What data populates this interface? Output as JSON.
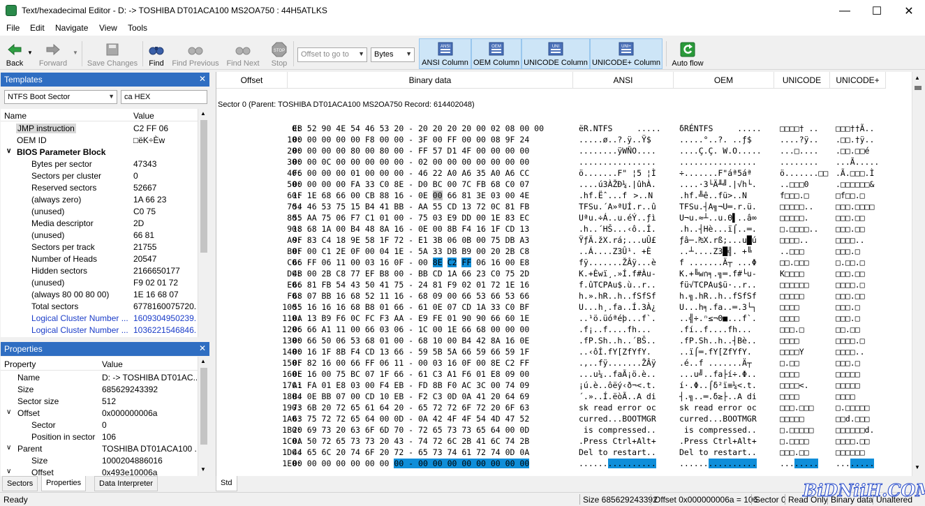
{
  "window": {
    "title": "Text/hexadecimal Editor - D: -> TOSHIBA DT01ACA100 MS2OA750 : 44H5ATLKS",
    "minimize": "—",
    "maximize": "☐",
    "close": "✕"
  },
  "menu": [
    "File",
    "Edit",
    "Navigate",
    "View",
    "Tools"
  ],
  "toolbar": {
    "back": "Back",
    "forward": "Forward",
    "save_changes": "Save Changes",
    "find": "Find",
    "find_previous": "Find Previous",
    "find_next": "Find Next",
    "stop": "Stop",
    "stop_icon_text": "STOP",
    "offset_placeholder": "Offset to go to",
    "units": "Bytes",
    "ansi_column": "ANSI Column",
    "oem_column": "OEM Column",
    "unicode_column": "UNICODE Column",
    "unicode_plus_column": "UNICODE+ Column",
    "auto_flow": "Auto flow",
    "icon_ansi": "ANSI",
    "icon_oem": "OEM",
    "icon_uni": "UNI",
    "icon_uni_plus": "UNI+"
  },
  "templates_panel": {
    "title": "Templates",
    "close": "✕",
    "template_select": "NTFS Boot Sector",
    "search_value": "ca HEX",
    "col_name": "Name",
    "col_value": "Value",
    "rows": [
      {
        "name": "JMP instruction",
        "value": "C2 FF 06",
        "indent": 0,
        "style": "sel"
      },
      {
        "name": "OEM ID",
        "value": "□ëK÷Èw",
        "indent": 0,
        "style": ""
      },
      {
        "name": "BIOS Parameter Block",
        "value": "",
        "indent": 0,
        "style": "bold",
        "toggle": "∨"
      },
      {
        "name": "Bytes per sector",
        "value": "47343",
        "indent": 1,
        "style": ""
      },
      {
        "name": "Sectors per cluster",
        "value": "0",
        "indent": 1,
        "style": ""
      },
      {
        "name": "Reserved sectors",
        "value": "52667",
        "indent": 1,
        "style": ""
      },
      {
        "name": "(always zero)",
        "value": "1A 66 23",
        "indent": 1,
        "style": ""
      },
      {
        "name": "(unused)",
        "value": "C0 75",
        "indent": 1,
        "style": ""
      },
      {
        "name": "Media descriptor",
        "value": "2D",
        "indent": 1,
        "style": ""
      },
      {
        "name": "(unused)",
        "value": "66 81",
        "indent": 1,
        "style": ""
      },
      {
        "name": "Sectors per track",
        "value": "21755",
        "indent": 1,
        "style": ""
      },
      {
        "name": "Number of Heads",
        "value": "20547",
        "indent": 1,
        "style": ""
      },
      {
        "name": "Hidden sectors",
        "value": "2166650177",
        "indent": 1,
        "style": ""
      },
      {
        "name": "(unused)",
        "value": "F9 02 01 72",
        "indent": 1,
        "style": ""
      },
      {
        "name": "(always 80 00 80 00)",
        "value": "1E 16 68 07",
        "indent": 1,
        "style": ""
      },
      {
        "name": "Total sectors",
        "value": "6778160075720...",
        "indent": 1,
        "style": ""
      },
      {
        "name": "Logical Cluster Number ...",
        "value": "1609304950239...",
        "indent": 1,
        "style": "link"
      },
      {
        "name": "Logical Cluster Number ...",
        "value": "1036221546846...",
        "indent": 1,
        "style": "link"
      }
    ]
  },
  "properties_panel": {
    "title": "Properties",
    "close": "✕",
    "col_property": "Property",
    "col_value": "Value",
    "rows": [
      {
        "name": "Name",
        "value": "D: -> TOSHIBA DT01AC...",
        "indent": 1,
        "toggle": ""
      },
      {
        "name": "Size",
        "value": "685629243392",
        "indent": 1,
        "toggle": ""
      },
      {
        "name": "Sector size",
        "value": "512",
        "indent": 1,
        "toggle": ""
      },
      {
        "name": "Offset",
        "value": "0x000000006a",
        "indent": 1,
        "toggle": "∨"
      },
      {
        "name": "Sector",
        "value": "0",
        "indent": 2,
        "toggle": ""
      },
      {
        "name": "Position in sector",
        "value": "106",
        "indent": 2,
        "toggle": ""
      },
      {
        "name": "Parent",
        "value": "TOSHIBA DT01ACA100 ...",
        "indent": 1,
        "toggle": "∨"
      },
      {
        "name": "Size",
        "value": "1000204886016",
        "indent": 2,
        "toggle": ""
      },
      {
        "name": "Offset",
        "value": "0x493e10006a",
        "indent": 2,
        "toggle": "∨"
      }
    ],
    "tabs": [
      "Sectors",
      "Properties",
      "Data Interpreter"
    ]
  },
  "hex": {
    "columns": [
      "Offset",
      "Binary data",
      "ANSI",
      "OEM",
      "UNICODE",
      "UNICODE+"
    ],
    "sector_label": "Sector 0 (Parent: TOSHIBA DT01ACA100 MS2OA750 Record: 614402048)",
    "bottom_tab": "Std",
    "rows": [
      {
        "o": "0:",
        "b": "EB 52 90 4E 54 46 53 20 - 20 20 20 20 00 02 08 00 00",
        "a": "ëR.NTFS     .....",
        "m": "δRÉNTFS     .....",
        "u": "□□□□† ..",
        "p": "□□□††Ã.."
      },
      {
        "o": "10:",
        "b": "00 00 00 00 00 F8 00 00 - 3F 00 FF 00 00 08 9F 24",
        "a": ".....ø..?.ÿ..Ÿ$",
        "m": ".....°..?. ..ƒ$",
        "u": "....?ÿ..",
        "p": ".□□.†ÿ.."
      },
      {
        "o": "20:",
        "b": "00 00 00 00 80 00 80 00 - FF 57 D1 4F 00 00 00 00",
        "a": "........ÿWÑO....",
        "m": "....Ç.Ç. W.O.....",
        "u": "...□....",
        "p": ".□□.□□é"
      },
      {
        "o": "30:",
        "b": "00 00 0C 00 00 00 00 00 - 02 00 00 00 00 00 00 00",
        "a": "................",
        "m": "................",
        "u": "........",
        "p": "...Ã....."
      },
      {
        "o": "40:",
        "b": "F6 00 00 00 01 00 00 00 - 46 22 A0 A6 35 A0 A6 CC",
        "a": "ö.......F\" ¦5 ¦Ì",
        "m": "÷.......F\"áª5áª",
        "u": "ö.......□□",
        "p": ".Ã.□□□.Ì"
      },
      {
        "o": "50:",
        "b": "00 00 00 00 FA 33 C0 8E - D0 BC 00 7C FB 68 C0 07",
        "a": "....ú3ÀŽÐ¼.|ûhÀ.",
        "m": "....·3└Ä╨╝.|√h└.",
        "u": "..□□□0",
        "p": ".□□□□□□&"
      },
      {
        "o": "60:",
        "b": "1F 1E 68 66 00 CB 88 16 - 0E 00 66 81 3E 03 00 4E",
        "a": ".hf.Ëˆ...f>..N",
        "m": ".hf.╩ê..fü>..N",
        "u": "f□□□.□",
        "p": "□f□□.□"
      },
      {
        "o": "70:",
        "b": "54 46 53 75 15 B4 41 BB - AA 55 CD 13 72 0C 81 FB",
        "a": "TFSu.´A»ªUÍ.r..û",
        "m": "TFSu.┤A╗¬U═.r.ü.",
        "u": "□□□□□..",
        "p": "□□□.□□□□"
      },
      {
        "o": "80:",
        "b": "55 AA 75 06 F7 C1 01 00 - 75 03 E9 DD 00 1E 83 EC",
        "a": "Uªu.÷Á..u.éÝ..ƒì",
        "m": "U¬u.≈┴..u.Θ▌..â∞",
        "u": "□□□□□.",
        "p": "□□□.□□"
      },
      {
        "o": "90:",
        "b": "18 68 1A 00 B4 48 8A 16 - 0E 00 8B F4 16 1F CD 13",
        "a": ".h..´HŠ...‹ô..Í.",
        "m": ".h..┤Hè...ï⌠..═.",
        "u": "□.□□□□..",
        "p": "□□□.□□"
      },
      {
        "o": "A0:",
        "b": "9F 83 C4 18 9E 58 1F 72 - E1 3B 06 0B 00 75 DB A3",
        "a": "ŸƒÄ.žX.rá;...uÛ£",
        "m": "ƒâ─.₧X.rß;...u█ú",
        "u": "□□□□..",
        "p": "□□□□.."
      },
      {
        "o": "B0:",
        "b": "0F 00 C1 2E 0F 00 04 1E - 5A 33 DB B9 00 20 2B C8",
        "a": "..Á....Z3Û¹. +È",
        "m": "..┴....Z3█╣. +╚",
        "u": "..□□□",
        "p": "□□□.□"
      },
      {
        "o": "C0:",
        "b": "66 FF 06 11 00 03 16 0F - 00 8E C2 FF 06 16 00 E8",
        "a": "fÿ.......ŽÂÿ...è",
        "m": "f .......Ä┬ ...Φ",
        "u": "□□.□□□",
        "p": "□.□□.□"
      },
      {
        "o": "D0:",
        "b": "4B 00 2B C8 77 EF B8 00 - BB CD 1A 66 23 C0 75 2D",
        "a": "K.+Èwï¸.»Í.f#Àu-",
        "m": "K.+╚w∩╕.╗═.f#└u-",
        "u": "K□□□□",
        "p": "□□□.□□"
      },
      {
        "o": "E0:",
        "b": "66 81 FB 54 43 50 41 75 - 24 81 F9 02 01 72 1E 16",
        "a": "f.ûTCPAu$.ù..r..",
        "m": "fü√TCPAu$ü·..r..",
        "u": "□□□□□□",
        "p": "□□□□.□"
      },
      {
        "o": "F0:",
        "b": "68 07 BB 16 68 52 11 16 - 68 09 00 66 53 66 53 66",
        "a": "h.».hR..h..fSfSf",
        "m": "h.╗.hR..h..fSfSf",
        "u": "□□□□□",
        "p": "□□□.□□"
      },
      {
        "o": "100:",
        "b": "55 16 16 16 68 B8 01 66 - 61 0E 07 CD 1A 33 C0 BF",
        "a": "U...h¸.fa..Í.3À¿",
        "m": "U...h╕.fa..═.3└┐",
        "u": "□□□□",
        "p": "□□□.□"
      },
      {
        "o": "110:",
        "b": "0A 13 B9 F6 0C FC F3 AA - E9 FE 01 90 90 66 60 1E",
        "a": "..¹ö.üóªéþ...f`.",
        "m": "..╣÷.ⁿ≤¬Θ■...f`.",
        "u": "□□□□",
        "p": "□□□.□"
      },
      {
        "o": "120:",
        "b": "06 66 A1 11 00 66 03 06 - 1C 00 1E 66 68 00 00 00",
        "a": ".f¡..f....fh...",
        "m": ".fí..f....fh...",
        "u": "□□□.□",
        "p": "□□.□□"
      },
      {
        "o": "130:",
        "b": "00 66 50 06 53 68 01 00 - 68 10 00 B4 42 8A 16 0E",
        "a": ".fP.Sh..h..´BŠ..",
        "m": ".fP.Sh..h..┤Bè..",
        "u": "□□□□",
        "p": "□□□□.□"
      },
      {
        "o": "140:",
        "b": "00 16 1F 8B F4 CD 13 66 - 59 5B 5A 66 59 66 59 1F",
        "a": "..‹ôÍ.fY[ZfYfY.",
        "m": "..ï⌠═.fY[ZfYfY.",
        "u": "□□□□Y",
        "p": "□□□□.."
      },
      {
        "o": "150:",
        "b": "0F 82 16 00 66 FF 06 11 - 00 03 16 0F 00 8E C2 FF",
        "a": ".‚..fÿ.......ŽÂÿ",
        "m": ".é..f .......Ä┬ ",
        "u": "□.□□",
        "p": "□□□.□"
      },
      {
        "o": "160:",
        "b": "0E 16 00 75 BC 07 1F 66 - 61 C3 A1 F6 01 E8 09 00",
        "a": "...u¼..faÃ¡ö.è..",
        "m": "...u╝..fa├í÷.Φ..",
        "u": "□□□□",
        "p": "□□□□□"
      },
      {
        "o": "170:",
        "b": "A1 FA 01 E8 03 00 F4 EB - FD 8B F0 AC 3C 00 74 09",
        "a": "¡ú.è..ôëý‹ð¬<.t.",
        "m": "í·.Φ..⌠δ²ï≡¼<.t.",
        "u": "□□□□<.",
        "p": "□□□□□"
      },
      {
        "o": "180:",
        "b": "B4 0E BB 07 00 CD 10 EB - F2 C3 0D 0A 41 20 64 69",
        "a": "´.»..Í.ëòÃ..A di",
        "m": "┤.╗..═.δ≥├..A di",
        "u": "□□□□",
        "p": "□□□□"
      },
      {
        "o": "190:",
        "b": "73 6B 20 72 65 61 64 20 - 65 72 72 6F 72 20 6F 63",
        "a": "sk read error oc",
        "m": "sk read error oc",
        "u": "□□□.□□□",
        "p": "□.□□□□□"
      },
      {
        "o": "1A0:",
        "b": "63 75 72 72 65 64 00 0D - 0A 42 4F 4F 54 4D 47 52",
        "a": "curred...BOOTMGR",
        "m": "curred...BOOTMGR",
        "u": "□□□□□",
        "p": "□□d.□□□"
      },
      {
        "o": "1B0:",
        "b": "20 69 73 20 63 6F 6D 70 - 72 65 73 73 65 64 00 0D",
        "a": " is compressed..",
        "m": " is compressed..",
        "u": "□.□□□□□",
        "p": "□□□□□□d."
      },
      {
        "o": "1C0:",
        "b": "0A 50 72 65 73 73 20 43 - 74 72 6C 2B 41 6C 74 2B",
        "a": ".Press Ctrl+Alt+",
        "m": ".Press Ctrl+Alt+",
        "u": "□.□□□□",
        "p": "□□□□.□□"
      },
      {
        "o": "1D0:",
        "b": "44 65 6C 20 74 6F 20 72 - 65 73 74 61 72 74 0D 0A",
        "a": "Del to restart..",
        "m": "Del to restart..",
        "u": "□□□.□□",
        "p": "□□□□□□"
      },
      {
        "o": "1E0:",
        "b": "00 00 00 00 00 00 00 00 - 00 00 00 00 00 00 00 00",
        "a": "................",
        "m": "................",
        "u": "........",
        "p": "........"
      }
    ]
  },
  "status": {
    "ready": "Ready",
    "size": "Size 685629243392",
    "offset": "Offset 0x000000006a = 106",
    "sector": "Sector 0",
    "mode": "Read Only",
    "data": "Binary data",
    "state": "Unaltered"
  },
  "watermark": "BiDNiiH.COM",
  "colors": {
    "selection": "#0f8ed9",
    "panel_active": "#2f6ec2",
    "link": "#1a3cc8"
  }
}
